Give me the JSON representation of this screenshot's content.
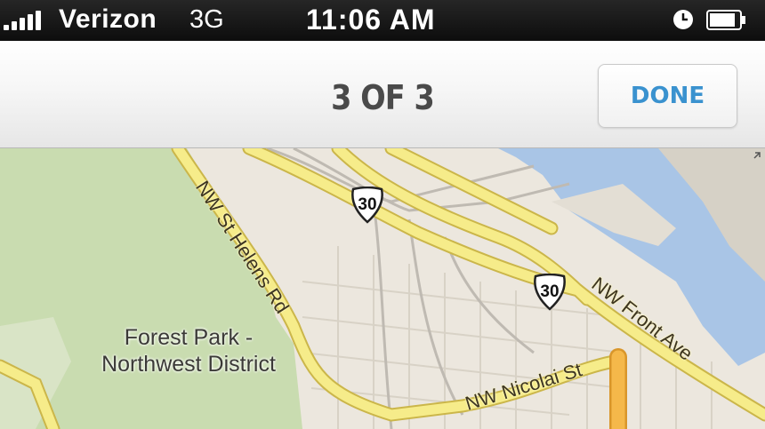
{
  "status_bar": {
    "carrier": "Verizon",
    "network": "3G",
    "time": "11:06 AM",
    "icons": [
      "signal-icon",
      "alarm-clock-icon",
      "battery-icon"
    ]
  },
  "nav": {
    "title": "3 OF 3",
    "done_label": "DONE",
    "accent_color": "#3a92cf"
  },
  "map": {
    "area_label": "Forest Park -\nNorthwest District",
    "streets": {
      "st_helens": "NW St Helens Rd",
      "front_ave": "NW Front Ave",
      "nicolai": "NW Nicolai St"
    },
    "route_shields": [
      "30",
      "30"
    ],
    "colors": {
      "land": "#ece7de",
      "park": "#c9dcb0",
      "water": "#a9c5e6",
      "road": "#f6ec8a"
    }
  }
}
